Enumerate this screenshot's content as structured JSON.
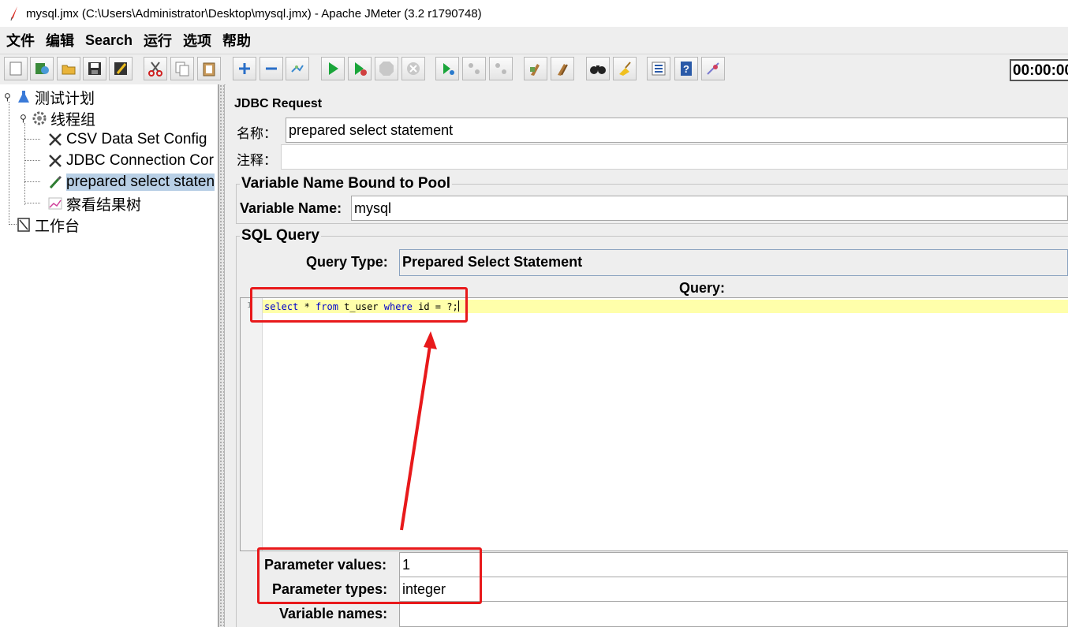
{
  "window": {
    "title": "mysql.jmx (C:\\Users\\Administrator\\Desktop\\mysql.jmx) - Apache JMeter (3.2 r1790748)"
  },
  "menu": {
    "items": [
      {
        "label": "文件"
      },
      {
        "label": "编辑"
      },
      {
        "label": "Search"
      },
      {
        "label": "运行"
      },
      {
        "label": "选项"
      },
      {
        "label": "帮助"
      }
    ]
  },
  "toolbar": {
    "timer": "00:00:00",
    "buttons": [
      "new-icon",
      "templates-icon",
      "open-icon",
      "save-icon",
      "save-as-icon",
      "cut-icon",
      "copy-icon",
      "paste-icon",
      "expand-icon",
      "collapse-icon",
      "toggle-icon",
      "start-icon",
      "start-no-pause-icon",
      "stop-icon",
      "shutdown-icon",
      "remote-start-icon",
      "remote-stop-icon",
      "remote-shutdown-icon",
      "clear-icon",
      "clear-all-icon",
      "search-icon",
      "reset-search-icon",
      "function-helper-icon",
      "help-icon",
      "log-viewer-icon"
    ]
  },
  "tree": {
    "items": [
      {
        "label": "测试计划"
      },
      {
        "label": "线程组"
      },
      {
        "label": "CSV Data Set Config"
      },
      {
        "label": "JDBC Connection Cor"
      },
      {
        "label": "prepared select staten"
      },
      {
        "label": "察看结果树"
      },
      {
        "label": "工作台"
      }
    ]
  },
  "panel": {
    "title": "JDBC Request",
    "name_label": "名称：",
    "name_value": "prepared select statement",
    "comment_label": "注释：",
    "comment_value": "",
    "pool_group_title": "Variable Name Bound to Pool",
    "variable_name_label": "Variable Name:",
    "variable_name_value": "mysql",
    "sql_group_title": "SQL Query",
    "query_type_label": "Query Type:",
    "query_type_value": "Prepared Select Statement",
    "query_label": "Query:",
    "query_line_number": "1",
    "query_tokens": {
      "select": "select",
      "star": " * ",
      "from": "from",
      "table": " t_user ",
      "where": "where",
      "rest": " id = ?;"
    },
    "param_values_label": "Parameter values:",
    "param_values_value": "1",
    "param_types_label": "Parameter types:",
    "param_types_value": "integer",
    "variable_names_label": "Variable names:",
    "variable_names_value": ""
  },
  "colors": {
    "highlight": "#e8191b",
    "selection": "#b8cfe5",
    "current_line": "#ffffaa",
    "keyword": "#0000cc"
  }
}
